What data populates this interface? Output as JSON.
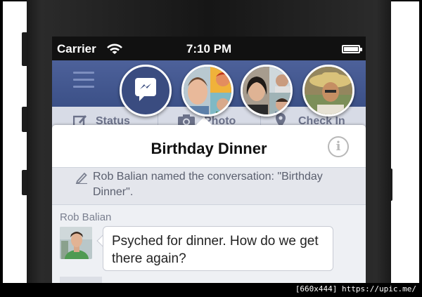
{
  "status_bar": {
    "carrier": "Carrier",
    "time": "7:10 PM",
    "wifi_icon": "wifi-icon",
    "battery_icon": "battery-icon",
    "battery_level": 0.9
  },
  "nav": {
    "menu_icon": "hamburger-menu-icon",
    "chat_heads": [
      "messenger-chathead",
      "group-chathead-1",
      "group-chathead-2",
      "contact-chathead"
    ]
  },
  "composer": {
    "items": [
      {
        "label": "Status",
        "icon": "pencil-square-icon"
      },
      {
        "label": "Photo",
        "icon": "camera-icon"
      },
      {
        "label": "Check In",
        "icon": "location-pin-icon"
      }
    ]
  },
  "conversation": {
    "title": "Birthday Dinner",
    "info_icon": "info-icon",
    "system_message": "Rob Balian named the conversation: \"Birthday Dinner\".",
    "messages": [
      {
        "sender": "Rob Balian",
        "text": "Psyched for dinner. How do we get there again?"
      }
    ]
  },
  "colors": {
    "fb_nav": "#3b5087",
    "chathead_border": "#ffffff",
    "thread_bg": "#eef0f4"
  },
  "watermark": "[660x444] https://upic.me/"
}
